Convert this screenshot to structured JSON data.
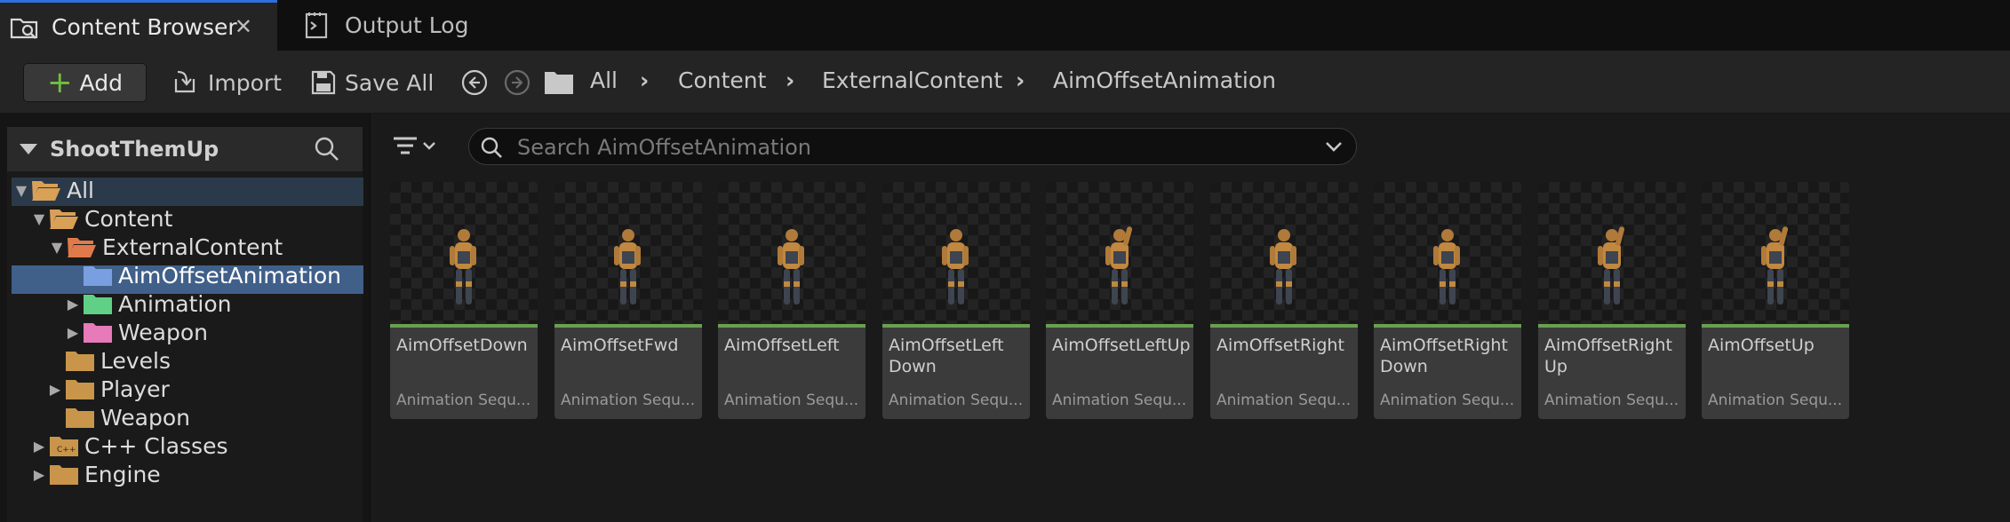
{
  "tabs": [
    {
      "label": "Content Browser",
      "active": true,
      "icon": "content-browser-icon"
    },
    {
      "label": "Output Log",
      "active": false,
      "icon": "output-log-icon"
    }
  ],
  "tab_close": "✕",
  "toolbar": {
    "add_label": "Add",
    "import_label": "Import",
    "save_all_label": "Save All"
  },
  "breadcrumb": [
    "All",
    "Content",
    "ExternalContent",
    "AimOffsetAnimation"
  ],
  "sources": {
    "title": "ShootThemUp",
    "tree": [
      {
        "label": "All",
        "color": "#d9a057",
        "open": true
      },
      {
        "label": "Content",
        "color": "#d9a057",
        "open": true
      },
      {
        "label": "ExternalContent",
        "color": "#e07a4a",
        "open": true
      },
      {
        "label": "AimOffsetAnimation",
        "color": "#7a9fe0",
        "selected": true
      },
      {
        "label": "Animation",
        "color": "#5fd085",
        "expandable": true
      },
      {
        "label": "Weapon",
        "color": "#e77ab8",
        "expandable": true
      },
      {
        "label": "Levels",
        "color": "#c8954a"
      },
      {
        "label": "Player",
        "color": "#c8954a",
        "expandable": true
      },
      {
        "label": "Weapon",
        "color": "#c8954a"
      },
      {
        "label": "C++ Classes",
        "color": "#c8954a",
        "expandable": true
      },
      {
        "label": "Engine",
        "color": "#c8954a",
        "expandable": true
      }
    ]
  },
  "search": {
    "placeholder": "Search AimOffsetAnimation"
  },
  "assets": [
    {
      "name": "AimOffsetDown",
      "type": "Animation Sequ..."
    },
    {
      "name": "AimOffsetFwd",
      "type": "Animation Sequ..."
    },
    {
      "name": "AimOffsetLeft",
      "type": "Animation Sequ..."
    },
    {
      "name": "AimOffsetLeft Down",
      "type": "Animation Sequ..."
    },
    {
      "name": "AimOffsetLeftUp",
      "type": "Animation Sequ..."
    },
    {
      "name": "AimOffsetRight",
      "type": "Animation Sequ..."
    },
    {
      "name": "AimOffsetRight Down",
      "type": "Animation Sequ..."
    },
    {
      "name": "AimOffsetRight Up",
      "type": "Animation Sequ..."
    },
    {
      "name": "AimOffsetUp",
      "type": "Animation Sequ..."
    }
  ],
  "colors": {
    "accent": "#2f6fe0",
    "selection": "#40608a",
    "asset_bar": "#6aa04f",
    "add_plus": "#70c040"
  }
}
